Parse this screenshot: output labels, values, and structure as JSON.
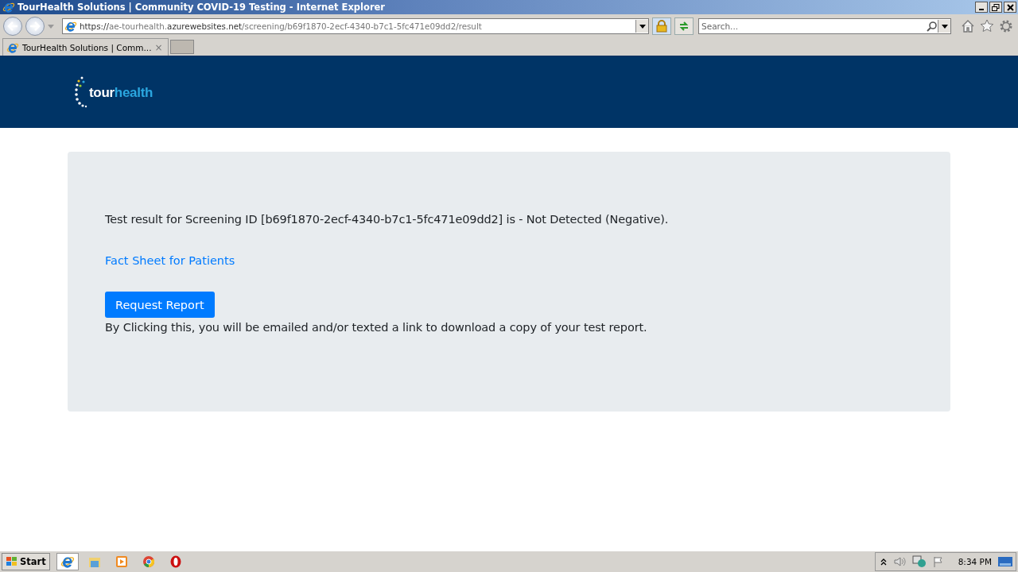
{
  "window": {
    "title": "TourHealth Solutions | Community COVID-19 Testing - Internet Explorer"
  },
  "address_bar": {
    "url_parts": [
      {
        "text": "https://",
        "emphasis": true
      },
      {
        "text": "ae-tourhealth.",
        "emphasis": false
      },
      {
        "text": "azurewebsites.net",
        "emphasis": true
      },
      {
        "text": "/screening/b69f1870-2ecf-4340-b7c1-5fc471e09dd2/result",
        "emphasis": false
      }
    ]
  },
  "search": {
    "placeholder": "Search..."
  },
  "tabs": [
    {
      "label": "TourHealth Solutions | Comm...",
      "selected": true,
      "close": "×"
    }
  ],
  "logo": {
    "words": [
      {
        "text": "tour",
        "color": "#ffffff"
      },
      {
        "text": "health",
        "color": "#2aa6df"
      }
    ]
  },
  "result": {
    "message": "Test result for Screening ID [b69f1870-2ecf-4340-b7c1-5fc471e09dd2] is - Not Detected (Negative).",
    "link": "Fact Sheet for Patients",
    "button": "Request Report",
    "note": "By Clicking this, you will be emailed and/or texted a link to download a copy of your test report."
  },
  "taskbar": {
    "start": "Start",
    "apps": [
      {
        "kind": "ie",
        "selected": true
      },
      {
        "kind": "folder",
        "selected": false
      },
      {
        "kind": "media",
        "selected": false
      },
      {
        "kind": "chrome",
        "selected": false
      },
      {
        "kind": "opera",
        "selected": false
      }
    ],
    "clock": "8:34 PM"
  }
}
